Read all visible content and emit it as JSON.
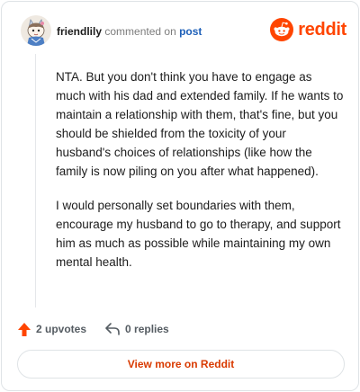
{
  "header": {
    "username": "friendlily",
    "action_text": "commented on",
    "post_link": "post",
    "brand_name": "reddit"
  },
  "comment": {
    "paragraphs": [
      "NTA. But you don't think you have to engage as much with his dad and extended family. If he wants to maintain a relationship with them, that's fine, but you should be shielded from the toxicity of your husband's choices of relationships (like how the family is now piling on you after what happened).",
      "I would personally set boundaries with them, encourage my husband to go to therapy, and support him as much as possible while maintaining my own mental health."
    ]
  },
  "actions": {
    "upvotes_label": "2 upvotes",
    "replies_label": "0 replies"
  },
  "footer": {
    "view_more_label": "View more on Reddit"
  },
  "icons": {
    "upvote": "upvote-arrow-icon",
    "reply": "reply-arrow-icon",
    "brand": "reddit-snoo-icon",
    "avatar": "user-avatar"
  },
  "colors": {
    "brand": "#ff4500",
    "link": "#1d5fb8",
    "view_more": "#d93a00",
    "upvote": "#ff4500"
  }
}
